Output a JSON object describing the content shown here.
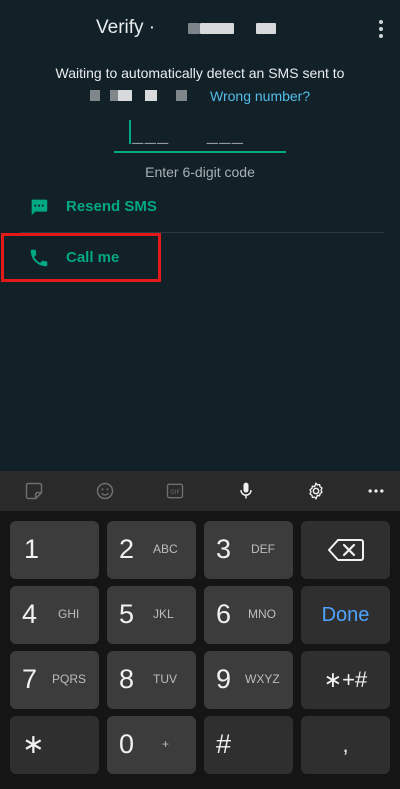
{
  "header": {
    "title": "Verify ·",
    "menu_icon": "more-vert-icon"
  },
  "message": {
    "waiting_text": "Waiting to automatically detect an SMS sent to",
    "wrong_number_link": "Wrong number?"
  },
  "code_input": {
    "placeholder_dashes": "___   ___",
    "hint": "Enter 6-digit code"
  },
  "actions": {
    "resend_sms": "Resend SMS",
    "call_me": "Call me"
  },
  "colors": {
    "accent": "#00a884",
    "link": "#53bdeb",
    "highlight": "#e31a1a",
    "done": "#4fa3ff"
  },
  "keyboard": {
    "toolbar": [
      "sticker-icon",
      "emoji-icon",
      "gif-icon",
      "microphone-icon",
      "settings-icon",
      "more-horiz-icon"
    ],
    "keys": {
      "k1": {
        "num": "1",
        "letters": ""
      },
      "k2": {
        "num": "2",
        "letters": "ABC"
      },
      "k3": {
        "num": "3",
        "letters": "DEF"
      },
      "k4": {
        "num": "4",
        "letters": "GHI"
      },
      "k5": {
        "num": "5",
        "letters": "JKL"
      },
      "k6": {
        "num": "6",
        "letters": "MNO"
      },
      "k7": {
        "num": "7",
        "letters": "PQRS"
      },
      "k8": {
        "num": "8",
        "letters": "TUV"
      },
      "k9": {
        "num": "9",
        "letters": "WXYZ"
      },
      "k0": {
        "num": "0",
        "letters": "+"
      },
      "star": "∗",
      "hash": "#",
      "comma": ",",
      "sym": "∗+#",
      "done": "Done"
    }
  }
}
